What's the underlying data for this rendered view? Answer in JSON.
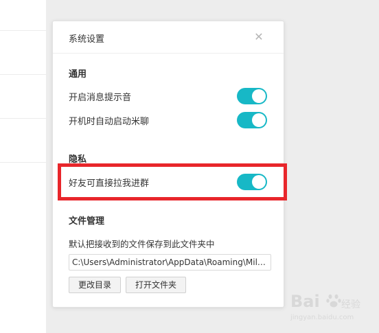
{
  "dialog": {
    "title": "系统设置",
    "close_icon": "close-icon"
  },
  "sections": {
    "general": {
      "heading": "通用",
      "items": [
        {
          "label": "开启消息提示音",
          "enabled": true
        },
        {
          "label": "开机时自动启动米聊",
          "enabled": true
        }
      ]
    },
    "privacy": {
      "heading": "隐私",
      "items": [
        {
          "label": "好友可直接拉我进群",
          "enabled": true
        }
      ]
    },
    "files": {
      "heading": "文件管理",
      "description": "默认把接收到的文件保存到此文件夹中",
      "path_value": "C:\\Users\\Administrator\\AppData\\Roaming\\Miliao",
      "change_dir_label": "更改目录",
      "open_folder_label": "打开文件夹"
    }
  },
  "colors": {
    "toggle_on": "#17b8c6",
    "highlight": "#e8262b"
  },
  "watermark": {
    "logo": "Bai",
    "sub": "经验",
    "url": "jingyan.baidu.com"
  }
}
